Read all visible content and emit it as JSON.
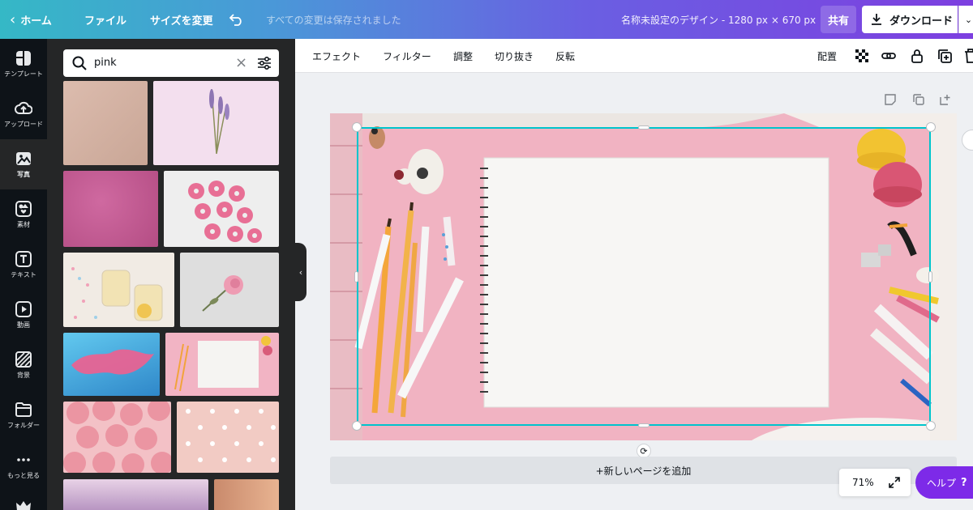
{
  "topbar": {
    "home": "ホーム",
    "file": "ファイル",
    "resize": "サイズを変更",
    "saved_status": "すべての変更は保存されました",
    "design_title": "名称未設定のデザイン - 1280 px × 670 px",
    "share": "共有",
    "download": "ダウンロード"
  },
  "sidebar": {
    "items": [
      {
        "label": "テンプレート",
        "icon": "template-icon"
      },
      {
        "label": "アップロード",
        "icon": "upload-icon"
      },
      {
        "label": "写真",
        "icon": "photo-icon"
      },
      {
        "label": "素材",
        "icon": "elements-icon"
      },
      {
        "label": "テキスト",
        "icon": "text-icon"
      },
      {
        "label": "動画",
        "icon": "video-icon"
      },
      {
        "label": "背景",
        "icon": "background-icon"
      },
      {
        "label": "フォルダー",
        "icon": "folder-icon"
      },
      {
        "label": "もっと見る",
        "icon": "more-icon"
      }
    ]
  },
  "photos": {
    "search_value": "pink",
    "results": [
      {
        "subject": "beige-paper-texture",
        "color": "#d3b2a2"
      },
      {
        "subject": "lavender-on-pink",
        "color": "#f2dcec"
      },
      {
        "subject": "pink-velvet-texture",
        "color": "#c2568d"
      },
      {
        "subject": "pink-donuts",
        "color": "#ececec"
      },
      {
        "subject": "lemonade-jars-confetti",
        "color": "#efe7df"
      },
      {
        "subject": "pink-rose-flat-lay",
        "color": "#dcdcdc"
      },
      {
        "subject": "pink-smoke-in-blue",
        "color": "#3fa7d8"
      },
      {
        "subject": "sketchbook-pink-flatlay",
        "color": "#f0b4c3"
      },
      {
        "subject": "pink-roses",
        "color": "#e89aa4"
      },
      {
        "subject": "polka-dot-pink",
        "color": "#f1c8c2"
      },
      {
        "subject": "lilac-light-gradient",
        "color": "#c6a4c9"
      },
      {
        "subject": "peach-gradient",
        "color": "#d9a182"
      }
    ]
  },
  "toolbar": {
    "effect": "エフェクト",
    "filter": "フィルター",
    "adjust": "調整",
    "crop": "切り抜き",
    "flip": "反転",
    "arrange": "配置"
  },
  "canvas": {
    "add_page": "+新しいページを追加",
    "zoom": "71%",
    "help": "ヘルプ",
    "help_mark": "?"
  },
  "colors": {
    "brand_purple": "#7d2ae8",
    "selection": "#00c4cc",
    "canvas_pink": "#f0b4c3"
  }
}
